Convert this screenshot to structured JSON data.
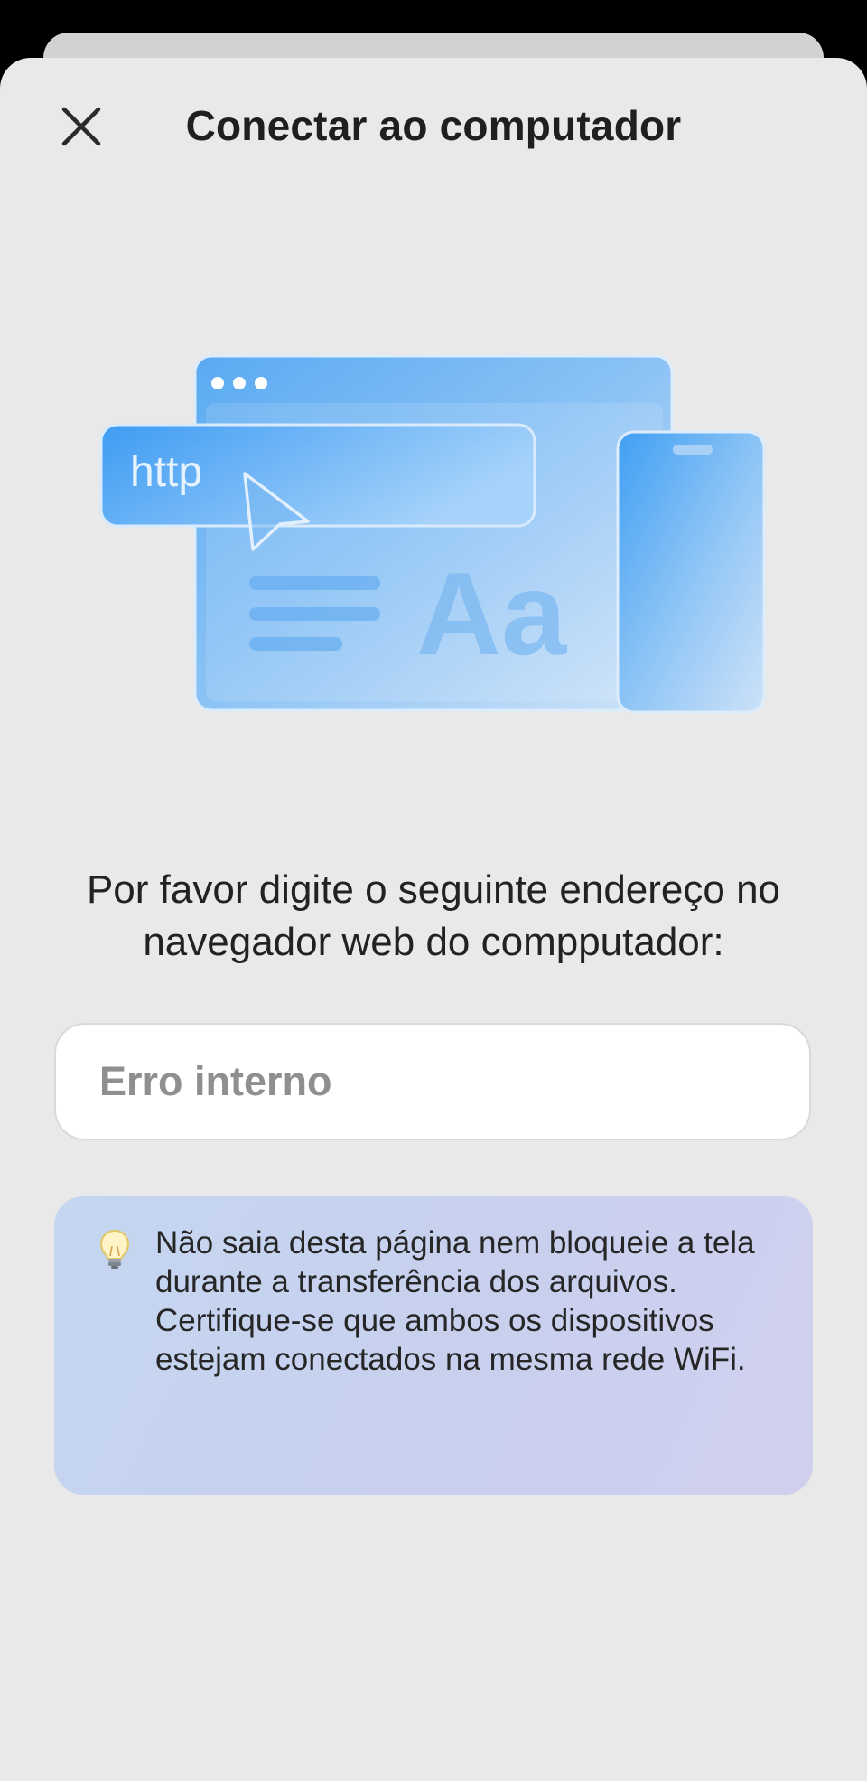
{
  "header": {
    "title": "Conectar ao computador",
    "close_icon": "close-icon"
  },
  "illustration": {
    "url_text": "http",
    "font_sample": "Aa",
    "accent_color": "#3f9cf3"
  },
  "instruction": "Por favor digite o seguinte endereço no navegador web do compputador:",
  "address_field": {
    "value": "Erro interno"
  },
  "tip": {
    "icon": "lightbulb-icon",
    "text": "Não saia desta página nem bloqueie a tela durante a transferência dos arquivos.\nCertifique-se que ambos os dispositivos estejam conectados na mesma rede WiFi."
  }
}
